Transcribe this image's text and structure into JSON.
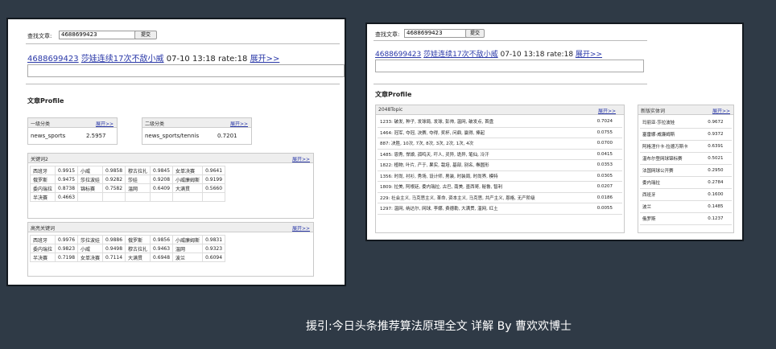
{
  "left": {
    "search_label": "查找文章:",
    "search_value": "4688699423",
    "submit_label": "提交",
    "headline": {
      "id": "4688699423",
      "title": "莎娃连续17次不敌小威",
      "meta": "07-10 13:18 rate:18",
      "more": "展开>>"
    },
    "profile_title": "文章Profile",
    "cat1": {
      "label": "一级分类",
      "more": "展开>>",
      "name": "news_sports",
      "value": "2.5957"
    },
    "cat2": {
      "label": "二级分类",
      "more": "展开>>",
      "name": "news_sports/tennis",
      "value": "0.7201"
    },
    "kw2": {
      "label": "关键词2",
      "more": "展开>>",
      "rows": [
        [
          [
            "西班牙",
            "0.9915"
          ],
          [
            "小威",
            "0.9858"
          ],
          [
            "穆古拉扎",
            "0.9845"
          ],
          [
            "女单决赛",
            "0.9641"
          ]
        ],
        [
          [
            "俄罗斯",
            "0.9475"
          ],
          [
            "莎拉波娃",
            "0.9282"
          ],
          [
            "莎娃",
            "0.9208"
          ],
          [
            "小威廉姆斯",
            "0.9199"
          ]
        ],
        [
          [
            "委内瑞拉",
            "0.8738"
          ],
          [
            "锦标赛",
            "0.7582"
          ],
          [
            "温网",
            "0.6409"
          ],
          [
            "大满贯",
            "0.5660"
          ]
        ],
        [
          [
            "半决赛",
            "0.4663"
          ]
        ]
      ]
    },
    "hq": {
      "label": "高亮关键词",
      "more": "展开>>",
      "rows": [
        [
          [
            "西班牙",
            "0.9976"
          ],
          [
            "莎拉波娃",
            "0.9886"
          ],
          [
            "俄罗斯",
            "0.9856"
          ],
          [
            "小威廉姆斯",
            "0.9831"
          ]
        ],
        [
          [
            "委内瑞拉",
            "0.9823"
          ],
          [
            "小威",
            "0.9498"
          ],
          [
            "穆古拉扎",
            "0.9463"
          ],
          [
            "温网",
            "0.9323"
          ]
        ],
        [
          [
            "半决赛",
            "0.7198"
          ],
          [
            "女单决赛",
            "0.7114"
          ],
          [
            "大满贯",
            "0.6948"
          ],
          [
            "波兰",
            "0.6094"
          ]
        ]
      ]
    }
  },
  "right": {
    "search_label": "查找文章:",
    "search_value": "4688699423",
    "submit_label": "提交",
    "headline": {
      "id": "4688699423",
      "title": "莎娃连续17次不敌小威",
      "meta": "07-10 13:18 rate:18",
      "more": "展开>>"
    },
    "profile_title": "文章Profile",
    "topic": {
      "label": "2048Topic",
      "more": "展开>>",
      "rows": [
        [
          "1233: 破发, 种子, 发球局, 发球, 彭帅, 温网, 破发点, 首盘",
          "0.7024"
        ],
        [
          "1464: 冠军, 夺冠, 决赛, 夺得, 奖杯, 问鼎, 赢得, 捧起",
          "0.0755"
        ],
        [
          "887: 决胜, 10次, 7次, 8次, 3次, 2次, 1次, 4次",
          "0.0700"
        ],
        [
          "1485: 恩秀, 悍娘, 孤鸣天, 吓人, 灵异, 诡异, 笔仙, 冷汗",
          "0.0415"
        ],
        [
          "1822: 植物, 叶片, 产于, 果实, 栽培, 基部, 别名, 椭圆形",
          "0.0353"
        ],
        [
          "1356: 时尚, 衬衫, 秀场, 设计师, 男装, 时装周, 时尚界, 模特",
          "0.0305"
        ],
        [
          "1809: 拉美, 阿根廷, 委内瑞拉, 古巴, 南美, 墨西哥, 秘鲁, 智利",
          "0.0207"
        ],
        [
          "229: 社会主义, 马克思主义, 革命, 资本主义, 马克思, 共产主义, 恩格, 无产阶级",
          "0.0186"
        ],
        [
          "1297: 温网, 纳达尔, 网球, 李娜, 费德勒, 大满贯, 温网, 红土",
          "0.0055"
        ]
      ]
    },
    "entity": {
      "label": "新版实体词",
      "more": "展开>>",
      "rows": [
        [
          "玛丽亚·莎拉波娃",
          "0.9672"
        ],
        [
          "塞雷娜·威廉姆斯",
          "0.9372"
        ],
        [
          "阿格涅什卡·拉德万斯卡",
          "0.6391"
        ],
        [
          "温布尔登网球锦标赛",
          "0.5021"
        ],
        [
          "法国网球公开赛",
          "0.2950"
        ],
        [
          "委内瑞拉",
          "0.2784"
        ],
        [
          "西班牙",
          "0.1600"
        ],
        [
          "波兰",
          "0.1485"
        ],
        [
          "俄罗斯",
          "0.1237"
        ]
      ]
    }
  },
  "caption": "援引:今日头条推荐算法原理全文 详解  By 曹欢欢博士"
}
